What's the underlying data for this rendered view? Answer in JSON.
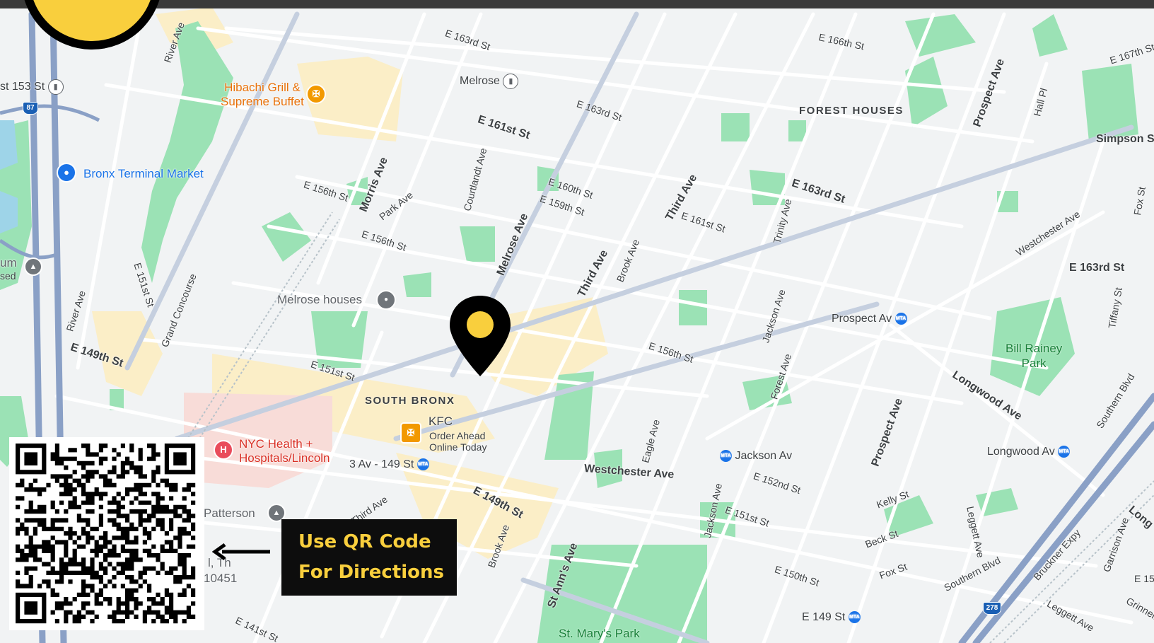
{
  "map": {
    "neighborhoods": {
      "forest_houses": "FOREST HOUSES",
      "south_bronx": "SOUTH BRONX"
    },
    "pois": {
      "hibachi_line1": "Hibachi Grill &",
      "hibachi_line2": "Supreme Buffet",
      "bronx_terminal_market": "Bronx Terminal Market",
      "melrose_houses": "Melrose houses",
      "nyc_health_line1": "NYC Health +",
      "nyc_health_line2": "Hospitals/Lincoln",
      "kfc": "KFC",
      "kfc_sub1": "Order Ahead",
      "kfc_sub2": "Online Today",
      "patterson": "Patterson",
      "partial_museum_1": "um",
      "partial_museum_2": "sed",
      "partial_address_1": "l, Th",
      "partial_address_2": "10451"
    },
    "parks": {
      "bill_rainey_line1": "Bill Rainey",
      "bill_rainey_line2": "Park",
      "st_marys": "St. Mary's Park"
    },
    "stations": {
      "melrose": "Melrose",
      "st_153": "st 153 St",
      "prospect_av": "Prospect Av",
      "jackson_av": "Jackson Av",
      "longwood_av": "Longwood Av",
      "e_149_st": "E 149 St",
      "three_av_149": "3 Av - 149 St"
    },
    "shields": {
      "i87": "87",
      "i278": "278"
    },
    "streets": {
      "e163rd_top": "E 163rd St",
      "e166th": "E 166th St",
      "e167th": "E 167th St",
      "e163rd_a": "E 163rd St",
      "e161st_a": "E 161st St",
      "e156th_a": "E 156th St",
      "morris": "Morris Ave",
      "park": "Park Ave",
      "courtlandt": "Courtlandt Ave",
      "e160th": "E 160th St",
      "e159th": "E 159th St",
      "melrose_ave": "Melrose Ave",
      "third_ave_a": "Third Ave",
      "third_ave_b": "Third Ave",
      "third_ave_c": "Third Ave",
      "e161st_b": "E 161st St",
      "e163rd_b": "E 163rd St",
      "trinity": "Trinity Ave",
      "brook_a": "Brook Ave",
      "brook_b": "Brook Ave",
      "e156th_b": "E 156th St",
      "e156th_c": "E 156th St",
      "jackson_ave_a": "Jackson Ave",
      "jackson_ave_b": "Jackson Ave",
      "forest_ave": "Forest Ave",
      "prospect_ave_a": "Prospect Ave",
      "prospect_ave_b": "Prospect Ave",
      "hall_pl": "Hall Pl",
      "simpson": "Simpson S",
      "westchester_a": "Westchester Ave",
      "westchester_b": "Westchester Ave",
      "e163rd_c": "E 163rd St",
      "tiffany": "Tiffany St",
      "fox_a": "Fox St",
      "fox_b": "Fox St",
      "longwood_ave": "Longwood Ave",
      "southern_a": "Southern Blvd",
      "southern_b": "Southern Blvd",
      "e151st_a": "E 151st St",
      "e151st_b": "E 151st St",
      "e151st_c": "E 151st St",
      "grand_concourse": "Grand Concourse",
      "river_a": "River Ave",
      "river_b": "River Ave",
      "e149th_a": "E 149th St",
      "e149th_b": "E 149th St",
      "eagle": "Eagle Ave",
      "e152nd": "E 152nd St",
      "e150th": "E 150th St",
      "kelly": "Kelly St",
      "beck": "Beck St",
      "leggett_a": "Leggett Ave",
      "leggett_b": "Leggett Ave",
      "bruckner": "Bruckner Expy",
      "garrison": "Garrison Ave",
      "grinnell": "Grinnell Pl",
      "st_anns": "St Ann's Ave",
      "e141st": "E 141st St",
      "e15": "E 15",
      "long": "Long"
    }
  },
  "callout": {
    "line1": "Use QR Code",
    "line2": "For Directions"
  },
  "colors": {
    "map_bg": "#f1f3f4",
    "park": "#9be2b5",
    "commercial": "#fbeec7",
    "brand_yellow": "#f9cf3d",
    "highway": "#8aa0c6",
    "subway_blue": "#1a73e8"
  },
  "icons": [
    "subway-icon",
    "rail-station-icon",
    "restaurant-icon",
    "shopping-icon",
    "hospital-icon",
    "museum-icon",
    "location-pin-icon",
    "arrow-left-icon",
    "qr-code-icon"
  ]
}
